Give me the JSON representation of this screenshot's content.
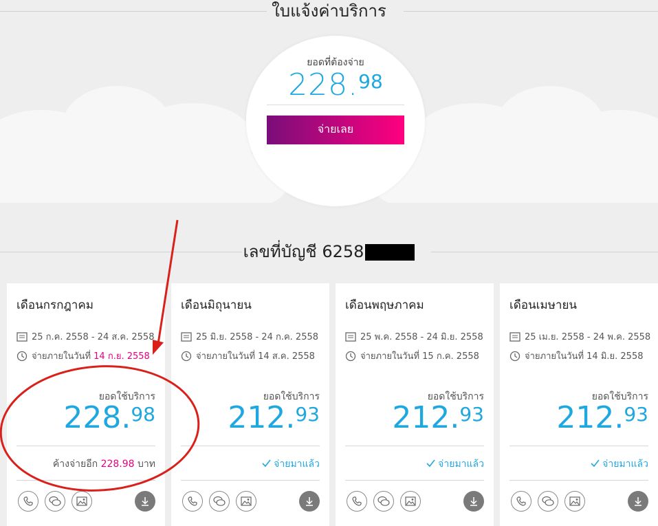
{
  "bill_title": "ใบแจ้งค่าบริการ",
  "summary": {
    "label": "ยอดที่ต้องจ่าย",
    "amount_int": "228.",
    "amount_dec": "98",
    "pay_button": "จ่ายเลย"
  },
  "account_title": "เลขที่บัญชี 6258",
  "cards": [
    {
      "month": "เดือนกรกฎาคม",
      "period": "25 ก.ค. 2558 - 24 ส.ค. 2558",
      "due_prefix": "จ่ายภายในวันที่",
      "due_date": "14 ก.ย. 2558",
      "usage_label": "ยอดใช้บริการ",
      "amount_int": "228.",
      "amount_dec": "98",
      "status_prefix": "ค้างจ่ายอีก",
      "status_amount": "228.98",
      "status_suffix": "บาท"
    },
    {
      "month": "เดือนมิถุนายน",
      "period": "25 มิ.ย. 2558 - 24 ก.ค. 2558",
      "due_prefix": "จ่ายภายในวันที่",
      "due_date": "14 ส.ค. 2558",
      "usage_label": "ยอดใช้บริการ",
      "amount_int": "212.",
      "amount_dec": "93",
      "status": "จ่ายมาแล้ว"
    },
    {
      "month": "เดือนพฤษภาคม",
      "period": "25 พ.ค. 2558 - 24 มิ.ย. 2558",
      "due_prefix": "จ่ายภายในวันที่",
      "due_date": "15 ก.ค. 2558",
      "usage_label": "ยอดใช้บริการ",
      "amount_int": "212.",
      "amount_dec": "93",
      "status": "จ่ายมาแล้ว"
    },
    {
      "month": "เดือนเมษายน",
      "period": "25 เม.ย. 2558 - 24 พ.ค. 2558",
      "due_prefix": "จ่ายภายในวันที่",
      "due_date": "14 มิ.ย. 2558",
      "usage_label": "ยอดใช้บริการ",
      "amount_int": "212.",
      "amount_dec": "93",
      "status": "จ่ายมาแล้ว"
    }
  ],
  "icons": [
    "document-icon",
    "clock-icon",
    "phone-icon",
    "chat-icon",
    "image-icon",
    "download-icon",
    "check-icon"
  ],
  "colors": {
    "accent_blue": "#1fa7e0",
    "accent_pink": "#e6007e",
    "gradient_start": "#7a0d7a",
    "gradient_end": "#ff007f",
    "annotation_red": "#d9201b"
  }
}
